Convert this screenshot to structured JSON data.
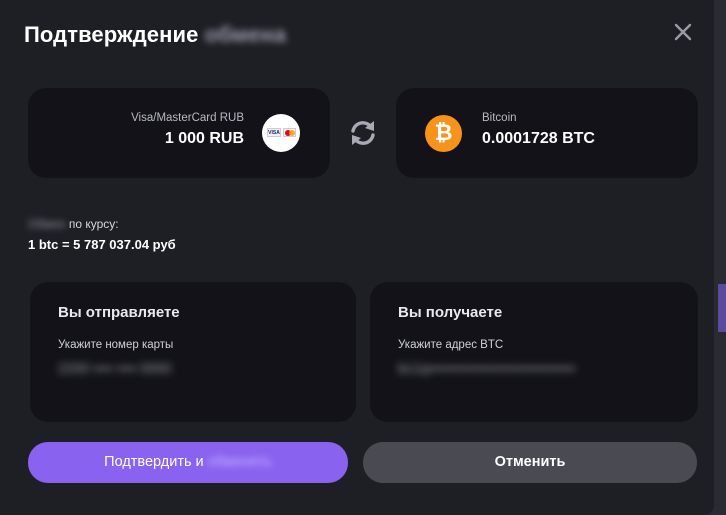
{
  "header": {
    "title": "Подтверждение",
    "title_blurred": "обмена",
    "close_icon": "close-icon"
  },
  "from": {
    "method": "Visa/MasterCard RUB",
    "amount": "1 000 RUB",
    "icon": "visa-mastercard-icon"
  },
  "swap_icon": "swap-arrows-icon",
  "to": {
    "currency": "Bitcoin",
    "amount": "0.0001728 BTC",
    "icon": "bitcoin-icon"
  },
  "rate": {
    "label_blurred": "Обмен",
    "label": "по курсу:",
    "value": "1 btc = 5 787 037.04 руб"
  },
  "send_panel": {
    "title": "Вы отправляете",
    "field_label": "Укажите номер карты",
    "field_value": "2200 •••• •••• 0000"
  },
  "receive_panel": {
    "title": "Вы получаете",
    "field_label": "Укажите адрес BTC",
    "field_value": "bc1q••••••••••••••••••••••••••••••"
  },
  "buttons": {
    "confirm": "Подтвердить и",
    "confirm_blurred": "обменять",
    "cancel": "Отменить"
  },
  "colors": {
    "background": "#1e1e25",
    "card": "#121218",
    "accent": "#8a62f0",
    "bitcoin": "#f7931a",
    "cancel": "#4a4a52"
  }
}
